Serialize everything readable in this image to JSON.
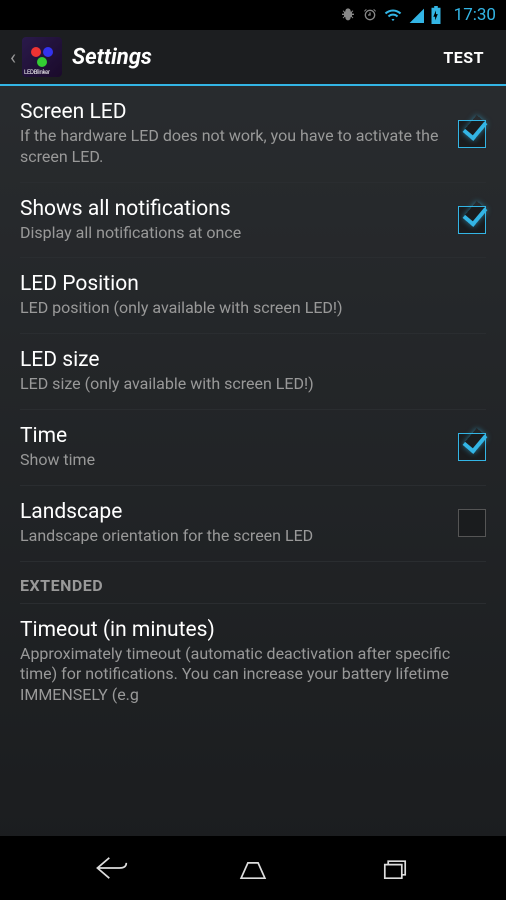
{
  "status": {
    "time": "17:30"
  },
  "header": {
    "title": "Settings",
    "action": "TEST",
    "app_icon_label": "LEDBlinker"
  },
  "settings": [
    {
      "title": "Screen LED",
      "sub": "If the hardware LED does not work, you have to activate the screen LED.",
      "checkbox": true,
      "checked": true
    },
    {
      "title": "Shows all notifications",
      "sub": "Display all notifications at once",
      "checkbox": true,
      "checked": true
    },
    {
      "title": "LED Position",
      "sub": "LED position (only available with screen LED!)",
      "checkbox": false
    },
    {
      "title": "LED size",
      "sub": "LED size (only available with screen LED!)",
      "checkbox": false
    },
    {
      "title": "Time",
      "sub": "Show time",
      "checkbox": true,
      "checked": true
    },
    {
      "title": "Landscape",
      "sub": "Landscape orientation for the screen LED",
      "checkbox": true,
      "checked": false
    }
  ],
  "section": "EXTENDED",
  "extended": [
    {
      "title": "Timeout (in minutes)",
      "sub": "Approximately timeout (automatic deactivation after specific time) for notifications. You can increase your battery lifetime IMMENSELY (e.g"
    }
  ]
}
